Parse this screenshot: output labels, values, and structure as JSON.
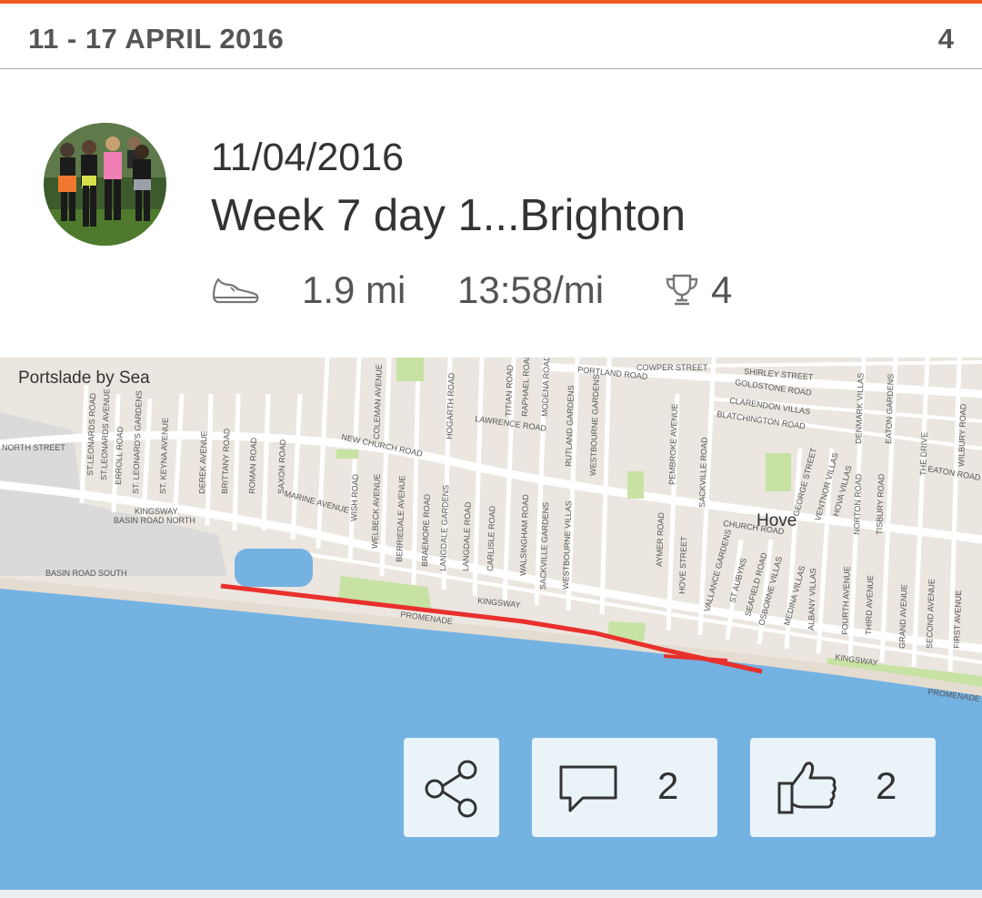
{
  "week_header": {
    "range": "11 - 17 APRIL 2016",
    "count": "4"
  },
  "activity": {
    "date": "11/04/2016",
    "title": "Week 7 day 1...Brighton",
    "distance": "1.9 mi",
    "pace": "13:58/mi",
    "trophies": "4",
    "icons": {
      "activity_type": "shoe-icon",
      "achievements": "trophy-icon"
    }
  },
  "map": {
    "places": {
      "portslade": "Portslade by Sea",
      "hove": "Hove"
    },
    "roads": [
      "NORTH STREET",
      "ST.LEONARDS ROAD",
      "ST.LEONARDS AVENUE",
      "ERROLL ROAD",
      "ST. LEONARD'S GARDENS",
      "ST. KEYNA AVENUE",
      "DEREK AVENUE",
      "BRITTANY ROAD",
      "ROMAN ROAD",
      "SAXON ROAD",
      "KINGSWAY",
      "BASIN ROAD NORTH",
      "BASIN ROAD SOUTH",
      "MARINE AVENUE",
      "WISH ROAD",
      "COLEMAN AVENUE",
      "WELBECK AVENUE",
      "BERRIEDALE AVENUE",
      "BRAEMORE ROAD",
      "LANGDALE GARDENS",
      "LANGDALE ROAD",
      "CARLISLE ROAD",
      "WALSINGHAM ROAD",
      "SACKVILLE GARDENS",
      "WESTBOURNE VILLAS",
      "NEW CHURCH ROAD",
      "HOGARTH ROAD",
      "LAWRENCE ROAD",
      "TITIAN ROAD",
      "RAPHAEL ROAD",
      "MODENA ROAD",
      "RUTLAND GARDENS",
      "WESTBOURNE GARDENS",
      "PORTLAND ROAD",
      "COWPER STREET",
      "SHIRLEY STREET",
      "GOLDSTONE ROAD",
      "CLARENDON VILLAS",
      "BLATCHINGTON ROAD",
      "PEMBROKE AVENUE",
      "SACKVILLE ROAD",
      "AYMER ROAD",
      "HOVE STREET",
      "VALLANCE GARDENS",
      "CHURCH ROAD",
      "ST AUBYNS",
      "SEAFIELD ROAD",
      "OSBORNE VILLAS",
      "MEDINA VILLAS",
      "ALBANY VILLAS",
      "FOURTH AVENUE",
      "THIRD AVENUE",
      "GEORGE STREET",
      "VENTNOR VILLAS",
      "HOVA VILLAS",
      "NORTON ROAD",
      "TISBURY ROAD",
      "DENMARK VILLAS",
      "EATON GARDENS",
      "THE DRIVE",
      "WILBURY ROAD",
      "EATON ROAD",
      "GRAND AVENUE",
      "SECOND AVENUE",
      "FIRST AVENUE",
      "PROMENADE"
    ],
    "colors": {
      "land": "#ebe6df",
      "sea": "#74b2e2",
      "park": "#c7e2a2",
      "road": "#ffffff",
      "route": "#e8302c"
    }
  },
  "actions": {
    "share": {
      "icon": "share-icon"
    },
    "comments": {
      "icon": "comment-icon",
      "count": "2"
    },
    "likes": {
      "icon": "thumbs-up-icon",
      "count": "2"
    }
  }
}
